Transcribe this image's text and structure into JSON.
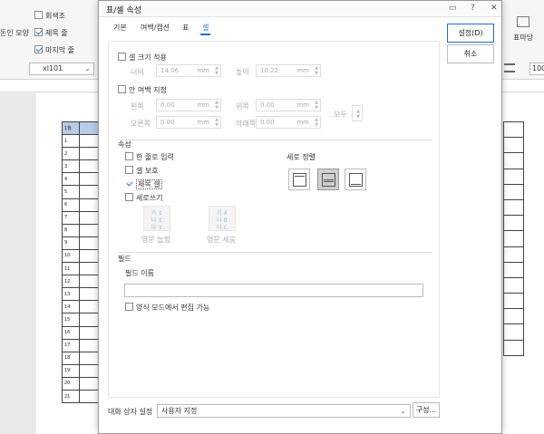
{
  "ribbon": {
    "chk_gray": "회색조",
    "chk_first": "돈인 모양",
    "chk_header": "제목 줄",
    "chk_last": "마지막 줄",
    "font": "xl101",
    "icon_label": "표마당",
    "zoom": "100"
  },
  "sheet": {
    "header": "1월",
    "rows": [
      "1",
      "2",
      "3",
      "4",
      "5",
      "6",
      "7",
      "8",
      "9",
      "10",
      "11",
      "12",
      "13",
      "14",
      "15",
      "16",
      "17",
      "18",
      "19",
      "20",
      "21"
    ]
  },
  "dialog": {
    "title": "표/셀 속성",
    "tabs": [
      "기본",
      "여백/캡션",
      "표",
      "셀"
    ],
    "active_tab": "셀",
    "cell_size": {
      "label": "셀 크기 적용",
      "width_label": "너비",
      "width_value": "14.06",
      "height_label": "높이",
      "height_value": "10.22",
      "unit": "mm"
    },
    "margin": {
      "label": "안 여백 지정",
      "left_label": "왼쪽",
      "left_value": "0.00",
      "top_label": "위쪽",
      "top_value": "0.00",
      "right_label": "오른쪽",
      "right_value": "0.00",
      "bottom_label": "아래쪽",
      "bottom_value": "0.00",
      "all_label": "모두",
      "unit": "mm"
    },
    "props": {
      "section": "속성",
      "single_line": "한 줄로 입력",
      "protect": "셀 보호",
      "title_cell": "제목 셀",
      "vertical": "세로쓰기",
      "v_align_label": "세로 정렬",
      "eng_rotate": "영문 눕힘",
      "eng_upright": "영문 세움"
    },
    "field": {
      "section": "필드",
      "name_label": "필드 이름",
      "value": "",
      "form_edit": "양식 모드에서 편집 가능"
    },
    "ok": "설정(D)",
    "cancel": "취소",
    "detail_label": "대화 상자 설정",
    "detail_value": "사용자 지정",
    "config_btn": "구성..."
  },
  "colors": {
    "accent": "#1f6fd1",
    "header_fill": "#b7cce5"
  }
}
